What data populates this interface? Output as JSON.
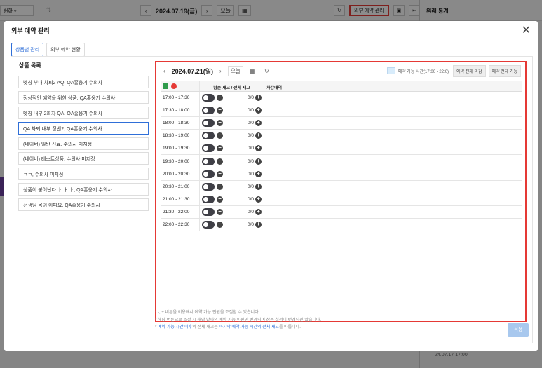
{
  "background": {
    "select_label": "현황",
    "date": "2024.07.19(금)",
    "today_label": "오늘",
    "external_button": "외부 예약 관리",
    "stats_title": "외래 통계",
    "bottom_text": "24.07.17 17:00"
  },
  "modal": {
    "title": "외부 예약 관리",
    "tabs": [
      "상품별 관리",
      "외부 예약 현황"
    ],
    "product_list": {
      "title": "상품 목록",
      "items": [
        "벳칭 부내 차퇴2 AQ, QA홍웅기 수의사",
        "정상적인 예약을 위한 상품, QA홍웅기 수의사",
        "벳칭 내부 2회차 QA, QA홍웅기 수의사",
        "QA 차퇴 내부 징벤2, QA홍웅기 수의사",
        "(네이버) 일반 진료, 수의사 미지정",
        "(네이버) 테스트상품, 수의사 미지정",
        "ㄱㄱ, 수의사 미지정",
        "상품이 붙어난다 ㅏ ㅏ ㅏ, QA홍웅기 수의사",
        "선생님 몸이 아파요, QA홍웅기 수의사"
      ],
      "selected_index": 3
    },
    "schedule": {
      "date": "2024.07.21(일)",
      "today_label": "오늘",
      "legend_text": "예약 가능 시간(17:00 - 22:0)",
      "close_all_label": "예약 전체 마감",
      "open_all_label": "예약 전체 가능",
      "col_remaining": "남은 재고 / 전체 재고",
      "col_history": "차감내역",
      "rows": [
        {
          "time": "17:00 - 17:30",
          "stock": "0/0"
        },
        {
          "time": "17:30 - 18:00",
          "stock": "0/0"
        },
        {
          "time": "18:00 - 18:30",
          "stock": "0/0"
        },
        {
          "time": "18:30 - 19:00",
          "stock": "0/0"
        },
        {
          "time": "19:00 - 19:30",
          "stock": "0/0"
        },
        {
          "time": "19:30 - 20:00",
          "stock": "0/0"
        },
        {
          "time": "20:00 - 20:30",
          "stock": "0/0"
        },
        {
          "time": "20:30 - 21:00",
          "stock": "0/0"
        },
        {
          "time": "21:00 - 21:30",
          "stock": "0/0"
        },
        {
          "time": "21:30 - 22:00",
          "stock": "0/0"
        },
        {
          "time": "22:00 - 22:30",
          "stock": "0/0"
        }
      ]
    },
    "notes": {
      "line1": "* -, + 버튼을 이용해서 예약 가능 인원을 조절할 수 있습니다.",
      "line2": "* 해당 버튼으로 조절 시 해당 날짜의 예약 가능 인원만 변경되며 상품 설정이 변경되진 않습니다.",
      "line3_prefix": "* ",
      "line3_blue1": "예약 가능 시간 이후",
      "line3_mid": "의 전체 재고는 ",
      "line3_blue2": "마지막 예약 가능 시간의 전체 재고",
      "line3_suffix": "를 따릅니다."
    },
    "apply_label": "적용"
  }
}
